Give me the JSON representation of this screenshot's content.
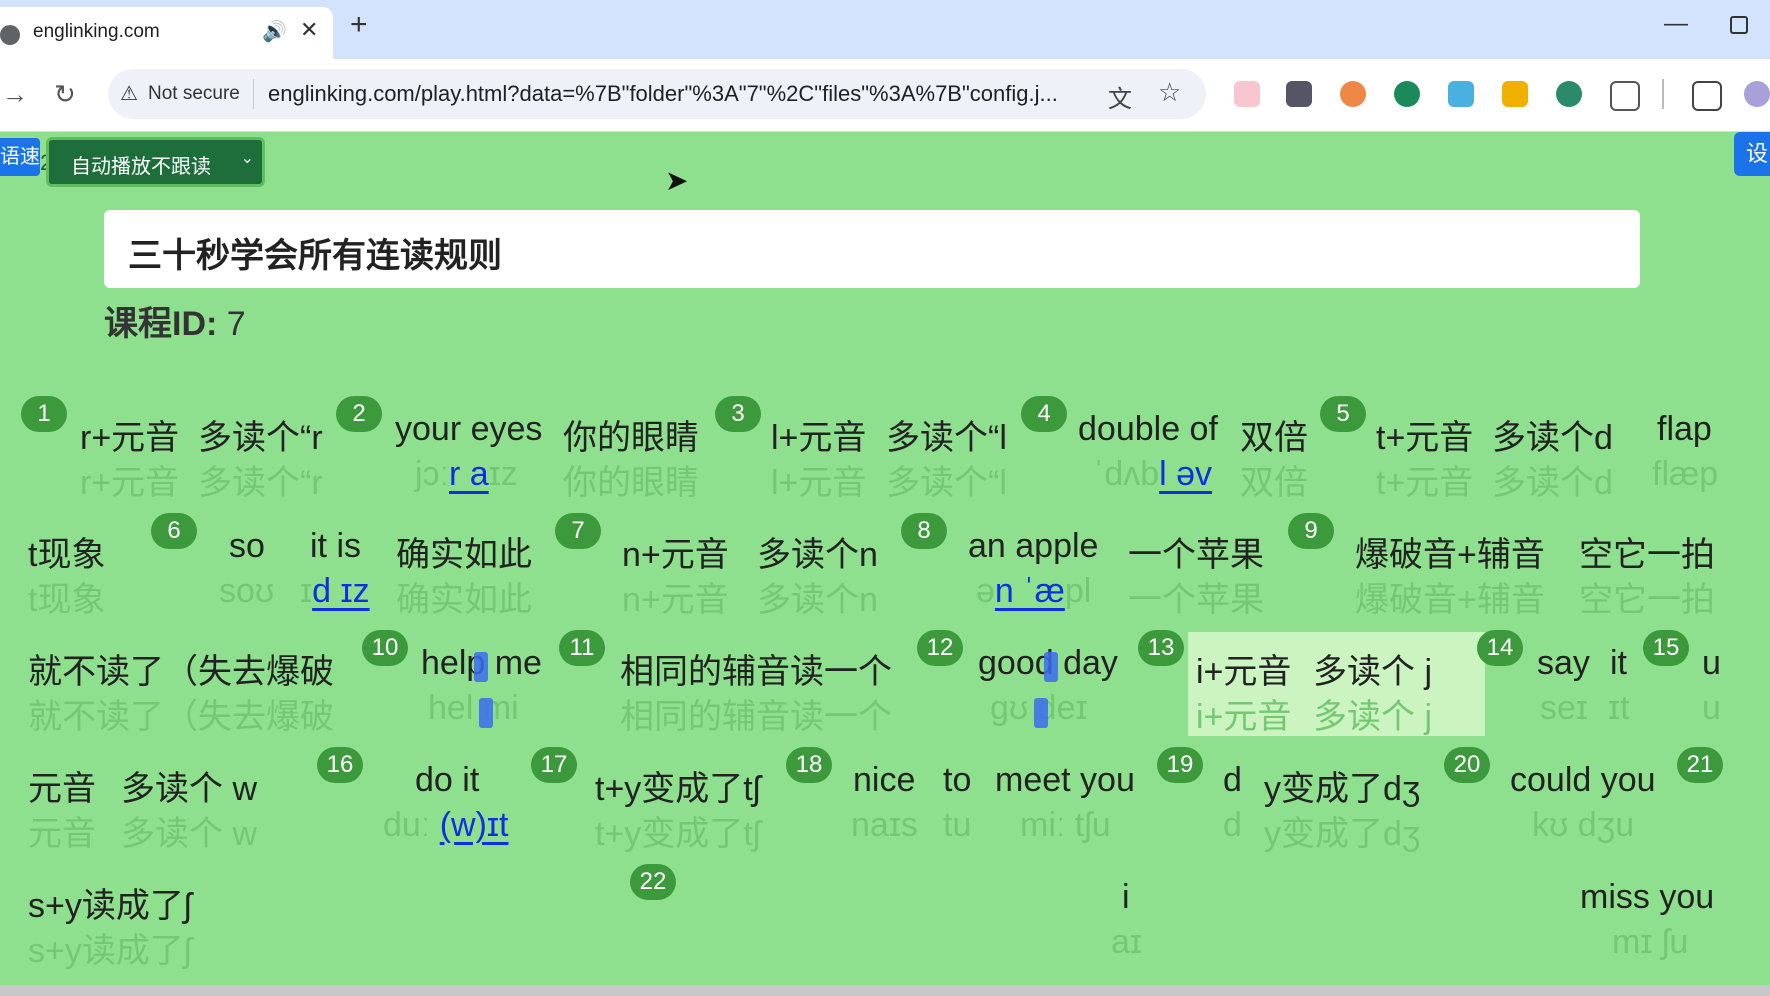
{
  "browser": {
    "tab": {
      "title": "englinking.com",
      "speaker_icon": "🔊",
      "close_icon": "✕"
    },
    "new_tab_icon": "+",
    "address": {
      "not_secure_label": "Not secure",
      "url": "englinking.com/play.html?data=%7B\"folder\"%3A\"7\"%2C\"files\"%3A%7B\"config.j..."
    },
    "icons": [
      "back-icon",
      "reload-icon",
      "translate-icon",
      "star-icon",
      "extensions-icon",
      "media-icon",
      "profile-avatar"
    ]
  },
  "page": {
    "speed_button": "语速",
    "speed_value": "2",
    "mode_select": {
      "selected": "自动播放不跟读"
    },
    "settings_button": "设",
    "lesson_title": "三十秒学会所有连读规则",
    "course_id_label": "课程ID:",
    "course_id_value": "7",
    "segments": [
      {
        "n": "1"
      },
      {
        "n": "2"
      },
      {
        "n": "3"
      },
      {
        "n": "4"
      },
      {
        "n": "5"
      },
      {
        "n": "6"
      },
      {
        "n": "7"
      },
      {
        "n": "8"
      },
      {
        "n": "9"
      },
      {
        "n": "10"
      },
      {
        "n": "11"
      },
      {
        "n": "12"
      },
      {
        "n": "13"
      },
      {
        "n": "14"
      },
      {
        "n": "15"
      },
      {
        "n": "16"
      },
      {
        "n": "17"
      },
      {
        "n": "18"
      },
      {
        "n": "19"
      },
      {
        "n": "20"
      },
      {
        "n": "21"
      },
      {
        "n": "22"
      }
    ],
    "words": {
      "r1": "r+元音",
      "r1p": "r+元音",
      "r2": "多读个“r",
      "r2p": "多读个“r",
      "ye": "your eyes",
      "yep_a": "jɔː",
      "yep_b": "r a",
      "yep_c": "ɪz",
      "ye_cn": "你的眼睛",
      "ye_cnp": "你的眼睛",
      "l1": "l+元音",
      "l1p": "l+元音",
      "l2": "多读个“l",
      "l2p": "多读个“l",
      "dbl": "double of",
      "dblp_a": "ˈdʌb",
      "dblp_b": "l əv",
      "dbl_cn": "双倍",
      "dbl_cnp": "双倍",
      "t1": "t+元音",
      "t1p": "t+元音",
      "t2": "多读个d",
      "t2p": "多读个d",
      "flap": "flap",
      "flapp": "flæp",
      "tx": "t现象",
      "txp": "t现象",
      "so": "so",
      "sop": "soʊ",
      "itis": "it is",
      "itisp_a": "ɪ",
      "itisp_b": "d ɪz",
      "qs": "确实如此",
      "qsp": "确实如此",
      "n1": "n+元音",
      "n1p": "n+元音",
      "n2": "多读个n",
      "n2p": "多读个n",
      "ap": "an apple",
      "app_a": "ə",
      "app_b": "n ˈæ",
      "app_c": "pl",
      "ap_cn": "一个苹果",
      "ap_cnp": "一个苹果",
      "bp1": "爆破音+辅音",
      "bp1p": "爆破音+辅音",
      "bp2": "空它一拍",
      "bp2p": "空它一拍",
      "js": "就不读了（失去爆破",
      "jsp": "就不读了（失去爆破",
      "hm": "help me",
      "hmp": "hel  mi",
      "xt": "相同的辅音读一个",
      "xtp": "相同的辅音读一个",
      "gd": "good day",
      "gdp": "gʊ  deɪ",
      "i1": "i+元音",
      "i1p": "i+元音",
      "i2": "多读个 j",
      "i2p": "多读个 j",
      "say": "say",
      "sayp": "seɪ",
      "it": "it",
      "itp": "ɪt",
      "u": "u",
      "up": "u",
      "yy": "元音",
      "yyp": "元音",
      "dw": "多读个 w",
      "dwp": "多读个 w",
      "doit": "do it",
      "doitp_a": "duː",
      "doitp_b": "(w)ɪt",
      "ty": "t+y变成了tʃ",
      "typ": "t+y变成了tʃ",
      "nice": "nice",
      "nicep": "naɪs",
      "to": "to",
      "top": "tu",
      "my": "meet you",
      "myp": "miː tʃu",
      "d": "d",
      "dp": "d",
      "dy": "y变成了dʒ",
      "dyp": "y变成了dʒ",
      "cy": "could you",
      "cyp": "kʊ dʒu",
      "sy": "s+y读成了ʃ",
      "syp": "s+y读成了ʃ",
      "ii": "i",
      "iip": "aɪ",
      "ms": "miss you",
      "msp": "mɪ ʃu"
    }
  },
  "colors": {
    "page_bg": "#8ee08e",
    "badge": "#3c9a3c",
    "phonetic": "#74c874",
    "highlight": "#1030e0",
    "active_bg": "#ccf4c0"
  }
}
